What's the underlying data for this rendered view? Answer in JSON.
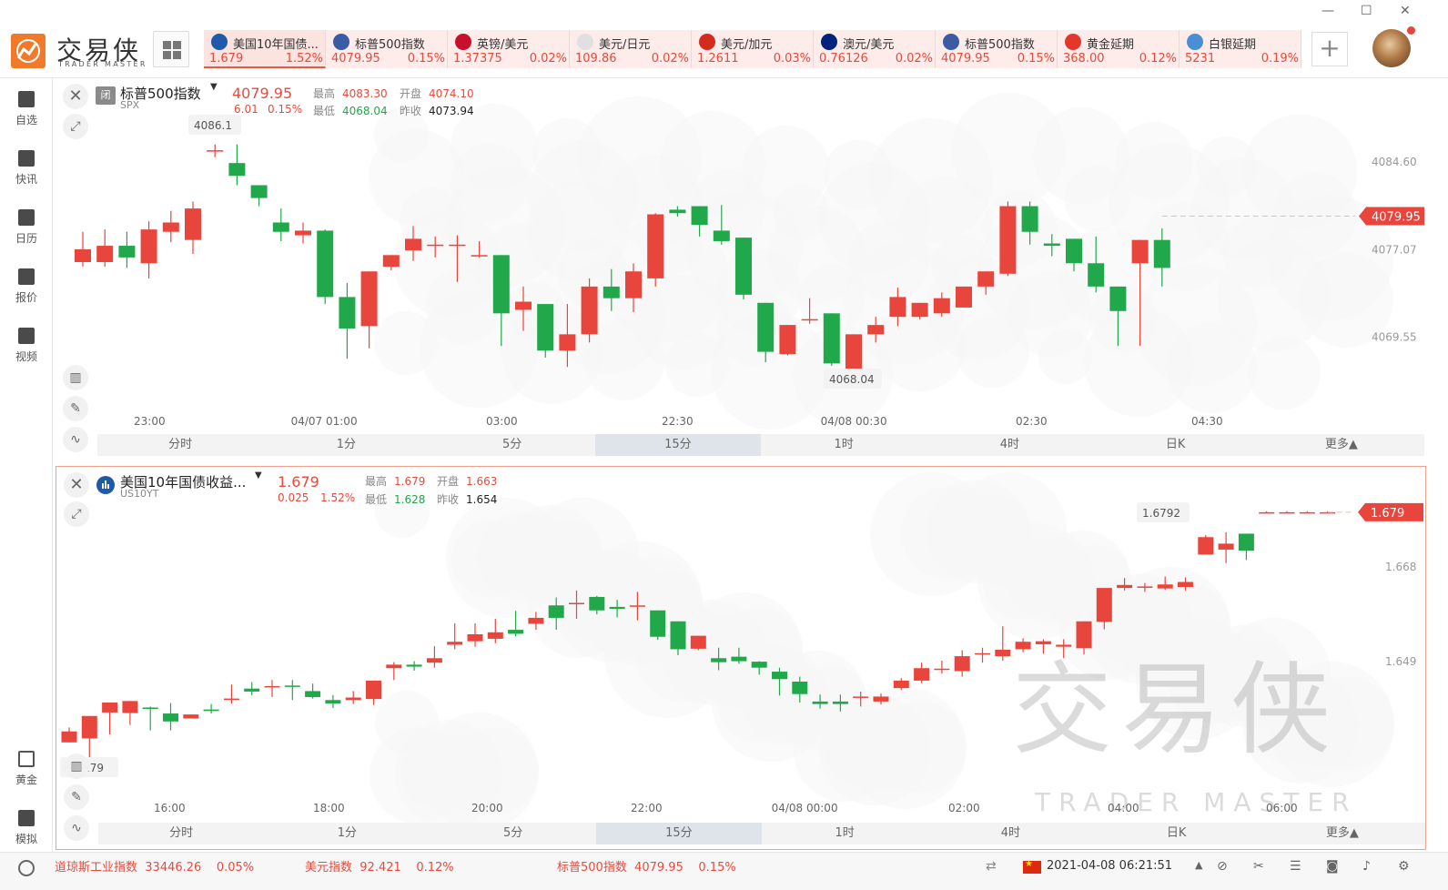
{
  "app": {
    "name": "交易侠",
    "subtitle": "TRADER MASTER"
  },
  "tabs": [
    {
      "name": "美国10年国债...",
      "price": "1.679",
      "pct": "1.52%",
      "flag": "us10y",
      "active": true
    },
    {
      "name": "标普500指数",
      "price": "4079.95",
      "pct": "0.15%",
      "flag": "us"
    },
    {
      "name": "英镑/美元",
      "price": "1.37375",
      "pct": "0.02%",
      "flag": "gbpusd"
    },
    {
      "name": "美元/日元",
      "price": "109.86",
      "pct": "0.02%",
      "flag": "usdjpy"
    },
    {
      "name": "美元/加元",
      "price": "1.2611",
      "pct": "0.03%",
      "flag": "usdcad"
    },
    {
      "name": "澳元/美元",
      "price": "0.76126",
      "pct": "0.02%",
      "flag": "audusd"
    },
    {
      "name": "标普500指数",
      "price": "4079.95",
      "pct": "0.15%",
      "flag": "us"
    },
    {
      "name": "黄金延期",
      "price": "368.00",
      "pct": "0.12%",
      "flag": "gold"
    },
    {
      "name": "白银延期",
      "price": "5231",
      "pct": "0.19%",
      "flag": "silver"
    }
  ],
  "nav": [
    {
      "label": "自选",
      "icon": "bookmark-icon"
    },
    {
      "label": "快讯",
      "icon": "list-icon"
    },
    {
      "label": "日历",
      "icon": "calendar-icon"
    },
    {
      "label": "报价",
      "icon": "chart-line-icon"
    },
    {
      "label": "视频",
      "icon": "play-icon"
    },
    {
      "label": "黄金",
      "icon": "gold-icon"
    },
    {
      "label": "模拟",
      "icon": "wallet-icon"
    }
  ],
  "periods": [
    "分时",
    "1分",
    "5分",
    "15分",
    "1时",
    "4时",
    "日K",
    "更多▲"
  ],
  "selected_period": "15分",
  "panel1": {
    "name": "标普500指数",
    "code": "SPX",
    "market_status": "闭",
    "price": "4079.95",
    "change": "6.01",
    "change_pct": "0.15%",
    "high_label": "最高",
    "high": "4083.30",
    "open_label": "开盘",
    "open": "4074.10",
    "low_label": "最低",
    "low": "4068.04",
    "prev_label": "昨收",
    "prev": "4073.94",
    "y_ticks": [
      "4084.60",
      "4077.07",
      "4069.55"
    ],
    "price_tag": "4079.95",
    "high_marker": "4086.1",
    "low_marker": "4068.04",
    "x_ticks": [
      "23:00",
      "04/07 01:00",
      "03:00",
      "22:30",
      "04/08 00:30",
      "02:30",
      "04:30"
    ]
  },
  "panel2": {
    "name": "美国10年国债收益...",
    "code": "US10YT",
    "price": "1.679",
    "change": "0.025",
    "change_pct": "1.52%",
    "high_label": "最高",
    "high": "1.679",
    "open_label": "开盘",
    "open": "1.663",
    "low_label": "最低",
    "low": "1.628",
    "prev_label": "昨收",
    "prev": "1.654",
    "y_ticks": [
      "1.668",
      "1.649"
    ],
    "price_tag": "1.679",
    "high_marker": "1.6792",
    "low_marker": "1.6279",
    "x_ticks": [
      "16:00",
      "18:00",
      "20:00",
      "22:00",
      "04/08 00:00",
      "02:00",
      "04:00",
      "06:00"
    ]
  },
  "watermark": {
    "name": "交易侠",
    "sub": "TRADER MASTER"
  },
  "status": {
    "items": [
      {
        "name": "道琼斯工业指数",
        "value": "33446.26",
        "pct": "0.05%"
      },
      {
        "name": "美元指数",
        "value": "92.421",
        "pct": "0.12%"
      },
      {
        "name": "标普500指数",
        "value": "4079.95",
        "pct": "0.15%"
      }
    ],
    "datetime": "2021-04-08 06:21:51"
  },
  "chart_data": [
    {
      "type": "candlestick",
      "title": "标普500指数",
      "ylim": [
        4066.0,
        4088.5
      ],
      "candles": [
        [
          4076.0,
          4077.1,
          4078.6,
          4075.6
        ],
        [
          4076.0,
          4077.4,
          4078.8,
          4075.6
        ],
        [
          4077.4,
          4076.4,
          4078.6,
          4075.5
        ],
        [
          4075.9,
          4078.8,
          4079.5,
          4074.6
        ],
        [
          4078.6,
          4079.4,
          4080.4,
          4077.7
        ],
        [
          4077.9,
          4080.6,
          4081.2,
          4076.7
        ],
        [
          4085.6,
          4085.6,
          4086.1,
          4085.0
        ],
        [
          4084.5,
          4083.4,
          4086.1,
          4082.6
        ],
        [
          4082.6,
          4081.5,
          4082.6,
          4080.8
        ],
        [
          4079.4,
          4078.6,
          4080.6,
          4077.8
        ],
        [
          4078.3,
          4078.7,
          4079.4,
          4077.6
        ],
        [
          4078.7,
          4073.0,
          4078.8,
          4072.4
        ],
        [
          4073.0,
          4070.3,
          4074.2,
          4067.7
        ],
        [
          4070.5,
          4075.2,
          4075.2,
          4068.6
        ],
        [
          4075.6,
          4076.6,
          4076.6,
          4075.3
        ],
        [
          4077.0,
          4078.0,
          4079.1,
          4076.1
        ],
        [
          4077.5,
          4077.5,
          4078.2,
          4076.4
        ],
        [
          4077.5,
          4077.5,
          4078.3,
          4074.3
        ],
        [
          4076.6,
          4076.6,
          4077.8,
          4076.4
        ],
        [
          4076.6,
          4071.6,
          4076.6,
          4068.8
        ],
        [
          4071.9,
          4072.6,
          4073.9,
          4070.1
        ],
        [
          4072.4,
          4068.4,
          4072.4,
          4067.8
        ],
        [
          4068.4,
          4069.8,
          4072.4,
          4067.0
        ],
        [
          4069.8,
          4073.9,
          4074.6,
          4069.1
        ],
        [
          4073.9,
          4072.9,
          4075.4,
          4071.8
        ],
        [
          4072.9,
          4075.2,
          4075.9,
          4071.7
        ],
        [
          4074.6,
          4080.1,
          4080.2,
          4073.9
        ],
        [
          4080.5,
          4080.2,
          4080.8,
          4079.9
        ],
        [
          4080.8,
          4079.2,
          4080.8,
          4078.2
        ],
        [
          4078.7,
          4077.8,
          4080.9,
          4077.5
        ],
        [
          4078.1,
          4073.2,
          4078.1,
          4072.8
        ],
        [
          4072.5,
          4068.3,
          4072.5,
          4067.4
        ],
        [
          4068.1,
          4070.6,
          4070.6,
          4068.0
        ],
        [
          4071.1,
          4071.1,
          4072.9,
          4070.7
        ],
        [
          4071.6,
          4067.3,
          4071.6,
          4067.1
        ],
        [
          4066.2,
          4069.8,
          4069.8,
          4066.0
        ],
        [
          4069.8,
          4070.6,
          4071.3,
          4069.1
        ],
        [
          4071.3,
          4073.0,
          4073.8,
          4070.5
        ],
        [
          4071.3,
          4072.5,
          4072.5,
          4071.1
        ],
        [
          4071.6,
          4072.9,
          4073.4,
          4071.3
        ],
        [
          4072.1,
          4073.9,
          4073.9,
          4072.1
        ],
        [
          4073.9,
          4075.2,
          4075.2,
          4073.2
        ],
        [
          4075.0,
          4080.8,
          4081.2,
          4074.8
        ],
        [
          4080.8,
          4078.6,
          4081.2,
          4077.5
        ],
        [
          4077.6,
          4077.4,
          4078.4,
          4076.5
        ],
        [
          4078.0,
          4075.9,
          4078.0,
          4075.2
        ],
        [
          4075.9,
          4073.9,
          4078.2,
          4073.4
        ],
        [
          4073.9,
          4071.8,
          4073.9,
          4068.8
        ],
        [
          4075.9,
          4077.9,
          4077.9,
          4068.8
        ],
        [
          4077.9,
          4075.5,
          4078.9,
          4073.9
        ]
      ]
    },
    {
      "type": "candlestick",
      "title": "美国10年国债收益...",
      "ylim": [
        1.626,
        1.683
      ],
      "candles": [
        [
          1.6328,
          1.635,
          1.6358,
          1.6328
        ],
        [
          1.6336,
          1.6381,
          1.6381,
          1.629
        ],
        [
          1.6388,
          1.6408,
          1.6408,
          1.6344
        ],
        [
          1.6387,
          1.6411,
          1.6411,
          1.6363
        ],
        [
          1.6398,
          1.6395,
          1.64,
          1.6352
        ],
        [
          1.6386,
          1.637,
          1.6407,
          1.6352
        ],
        [
          1.6376,
          1.6384,
          1.6384,
          1.6376
        ],
        [
          1.6394,
          1.6391,
          1.6405,
          1.6386
        ],
        [
          1.6415,
          1.6416,
          1.6444,
          1.6406
        ],
        [
          1.6436,
          1.643,
          1.6449,
          1.6423
        ],
        [
          1.644,
          1.6441,
          1.6453,
          1.6419
        ],
        [
          1.6442,
          1.644,
          1.6453,
          1.6413
        ],
        [
          1.6431,
          1.6419,
          1.6446,
          1.6416
        ],
        [
          1.6413,
          1.6406,
          1.6423,
          1.6397
        ],
        [
          1.6413,
          1.6418,
          1.6431,
          1.6405
        ],
        [
          1.6415,
          1.6452,
          1.6452,
          1.6403
        ],
        [
          1.6477,
          1.6484,
          1.6489,
          1.6453
        ],
        [
          1.6484,
          1.648,
          1.6491,
          1.6472
        ],
        [
          1.6488,
          1.6497,
          1.6521,
          1.6478
        ],
        [
          1.6524,
          1.653,
          1.6567,
          1.6515
        ],
        [
          1.6531,
          1.6545,
          1.6567,
          1.652
        ],
        [
          1.6536,
          1.6549,
          1.6576,
          1.6527
        ],
        [
          1.6554,
          1.6546,
          1.6592,
          1.6541
        ],
        [
          1.6566,
          1.6578,
          1.659,
          1.6554
        ],
        [
          1.6603,
          1.6578,
          1.6619,
          1.6554
        ],
        [
          1.6608,
          1.6608,
          1.6633,
          1.6576
        ],
        [
          1.662,
          1.6593,
          1.6622,
          1.6585
        ],
        [
          1.66,
          1.6596,
          1.6614,
          1.6579
        ],
        [
          1.6603,
          1.6603,
          1.663,
          1.6573
        ],
        [
          1.6593,
          1.654,
          1.6593,
          1.6534
        ],
        [
          1.6571,
          1.6515,
          1.6571,
          1.6503
        ],
        [
          1.6516,
          1.6542,
          1.6542,
          1.6513
        ],
        [
          1.6497,
          1.6489,
          1.6518,
          1.6473
        ],
        [
          1.65,
          1.6491,
          1.6518,
          1.6486
        ],
        [
          1.649,
          1.6478,
          1.6491,
          1.6464
        ],
        [
          1.647,
          1.6455,
          1.6478,
          1.6422
        ],
        [
          1.645,
          1.6425,
          1.646,
          1.6408
        ],
        [
          1.641,
          1.6405,
          1.6424,
          1.6396
        ],
        [
          1.641,
          1.6405,
          1.6424,
          1.639
        ],
        [
          1.642,
          1.642,
          1.643,
          1.64
        ],
        [
          1.641,
          1.642,
          1.6426,
          1.6404
        ],
        [
          1.6437,
          1.6452,
          1.6457,
          1.6433
        ],
        [
          1.6452,
          1.6477,
          1.6488,
          1.6447
        ],
        [
          1.6474,
          1.6476,
          1.6492,
          1.6466
        ],
        [
          1.6471,
          1.6501,
          1.6513,
          1.646
        ],
        [
          1.6507,
          1.6507,
          1.6518,
          1.6488
        ],
        [
          1.6501,
          1.6514,
          1.6561,
          1.6492
        ],
        [
          1.6515,
          1.653,
          1.6537,
          1.6509
        ],
        [
          1.6525,
          1.6531,
          1.6535,
          1.6506
        ],
        [
          1.652,
          1.6524,
          1.6535,
          1.6497
        ],
        [
          1.6517,
          1.6571,
          1.6571,
          1.6505
        ],
        [
          1.657,
          1.6638,
          1.6638,
          1.6555
        ],
        [
          1.6638,
          1.6644,
          1.6658,
          1.6633
        ],
        [
          1.6641,
          1.6641,
          1.6648,
          1.663
        ],
        [
          1.6637,
          1.6645,
          1.6661,
          1.6634
        ],
        [
          1.664,
          1.665,
          1.6659,
          1.6633
        ],
        [
          1.6705,
          1.674,
          1.6744,
          1.6705
        ],
        [
          1.6715,
          1.6727,
          1.675,
          1.6688
        ],
        [
          1.6747,
          1.6713,
          1.6747,
          1.6694
        ],
        [
          1.679,
          1.679,
          1.6792,
          1.6789
        ],
        [
          1.679,
          1.679,
          1.6792,
          1.6789
        ],
        [
          1.679,
          1.679,
          1.6792,
          1.6789
        ],
        [
          1.679,
          1.679,
          1.6792,
          1.6789
        ]
      ]
    }
  ]
}
